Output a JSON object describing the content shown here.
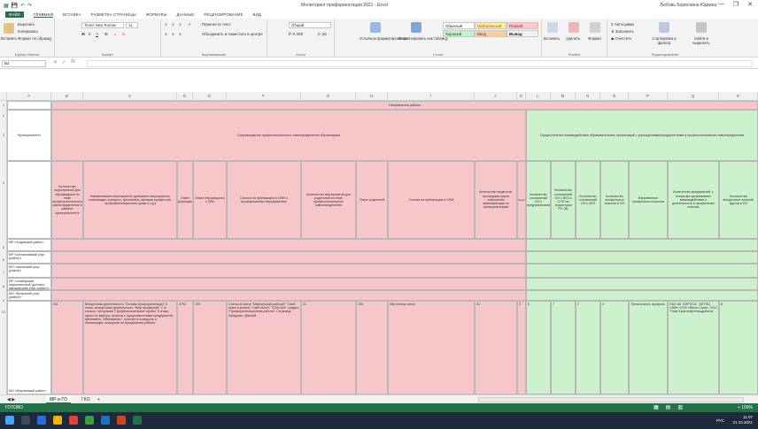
{
  "window": {
    "title": "Мониторинг профориентации 2021 - Excel",
    "user": "Любовь Борисовна Юдкина",
    "controls": [
      "—",
      "❐",
      "✕"
    ]
  },
  "ribbon_tabs": [
    "ФАЙЛ",
    "ГЛАВНАЯ",
    "ВСТАВКА",
    "РАЗМЕТКА СТРАНИЦЫ",
    "ФОРМУЛЫ",
    "ДАННЫЕ",
    "РЕЦЕНЗИРОВАНИЕ",
    "ВИД"
  ],
  "ribbon": {
    "clipboard": {
      "paste": "Вставить",
      "cut": "Вырезать",
      "copy": "Копировать",
      "format": "Формат по образцу",
      "label": "Буфер обмена"
    },
    "font": {
      "name": "Times New Roman",
      "size": "11",
      "label": "Шрифт"
    },
    "alignment": {
      "wrap": "Перенести текст",
      "merge": "Объединить и поместить в центре",
      "label": "Выравнивание"
    },
    "number": {
      "format": "Общий",
      "label": "Число"
    },
    "styles": {
      "conditional": "Условное форматирование",
      "as_table": "Форматировать как таблицу",
      "cells": [
        "Обычный",
        "Нейтральный",
        "Плохой",
        "Хороший",
        "Ввод",
        "Вывод"
      ],
      "label": "Стили"
    },
    "cells_group": {
      "insert": "Вставить",
      "delete": "Удалить",
      "format": "Формат",
      "label": "Ячейки"
    },
    "editing": {
      "autosum": "Автосумма",
      "fill": "Заполнить",
      "clear": "Очистить",
      "sort": "Сортировка и фильтр",
      "find": "Найти и выделить",
      "label": "Редактирование"
    }
  },
  "formula_bar": {
    "name_box": "B2",
    "fx": "fx"
  },
  "columns": [
    "A",
    "B",
    "C",
    "D",
    "E",
    "F",
    "G",
    "H",
    "I",
    "J",
    "K",
    "L",
    "M",
    "N",
    "O",
    "P",
    "Q",
    "R",
    "S",
    "T"
  ],
  "rows": [
    "1",
    "2",
    "3",
    "4",
    "5",
    "6",
    "7",
    "8",
    "9",
    "10",
    "11",
    "12",
    "13"
  ],
  "table": {
    "top_header": "Направления работы",
    "left_header": "Муниципалитет",
    "pink_header": "Сопровождение профессионального самоопределения обучающихся",
    "green_header": "Осуществление взаимодействия образовательных организаций с учреждениями/предприятиями в профессиональном самоопределении",
    "sub_headers": [
      "Количество мероприятий для обучающихся по теме профессионального самоопределения в районе/муниципалитете",
      "Наименование мероприятий (указывать мероприятия: олимпиады, конкурсы, фестивали, ярмарки профессий, профориентационные уроки и т.д.)",
      "Охват обучающихся",
      "Охват обучающихся с ОВЗ",
      "Ссылка на публикацию в СМИ о вышеуказанных мероприятиях",
      "Количество мероприятий для родителей по теме профессионального самоопределения",
      "Охват родителей",
      "Ссылка на публикацию в СМИ",
      "Количество педагогов, прошедших курсы повышения квалификации по профориентации",
      "Ссылка",
      "Количество соглашений ОО с предприятиями",
      "Количество соглашений ОО с ВУЗ и СПО на территории РС (Я)",
      "Количество соглашений ОО с ВУЗ",
      "Количество профильных классов в ОО",
      "Направление профильных классов",
      "Количество предприятий, с которыми организовано взаимодействие и деятельность в профильных классах",
      "Количество внеурочных занятий, курсов в ОО"
    ],
    "districts": [
      "МР «Алданский район»",
      "МР «Аллаиховский улус (район)»",
      "МО «Амгинский улус (район)»",
      "МР «Анабарский национальный (долгано-эвенкийский) улус (район)»",
      "МО «Булунский улус (район)»"
    ],
    "mirny": {
      "district": "МО «Мирнинский район»",
      "count": "411",
      "events": "Внеурочная деятельность \"Основы профориентации\" 5 класс; внеурочная деятельность \"Мир профессий\" 7, 8 классы; программа \"Профессиональные пробы\" 9 класс; курсы по выбору; встречи с представителями предприятий; фестиваль \"Абилимпикс\"; участие в конкурсах и олимпиадах; экскурсии на предприятия района",
      "coverage": "4792",
      "coverage_ovz": "109",
      "media_link": "Статьи в газете \"Мирнинский рабочий\" \"Свой шанс в успехе\"; Сайт МАОУ \"СОШ №8\"; раздел \"Профориентационная работа\"; Страница Instagram: @soch8",
      "parents_events": "31",
      "parents_coverage": "105",
      "parents_link": "http://mirny.ru/edu",
      "teachers": "31",
      "link_small": "0",
      "agreements_ent": "6",
      "agreements_vuz_spo": "7",
      "agreements_vuz": "2",
      "profile_classes": "4",
      "profile_direction": "Технологичес профиль",
      "enterprises": "ПАО АК \"АЛРОСА\", МГТПЦ СВФУ, ООО «Янгас Саха», ООО \"Глав Юрм нефтегазодобыча\"",
      "extracurricular": "8"
    }
  },
  "sheet_tabs": [
    "МР и ГО",
    "ГКО",
    "+"
  ],
  "status": {
    "ready": "ГОТОВО",
    "zoom": "+ 100%"
  },
  "taskbar": {
    "lang": "РУС",
    "time": "11:07",
    "date": "21.10.2021"
  }
}
